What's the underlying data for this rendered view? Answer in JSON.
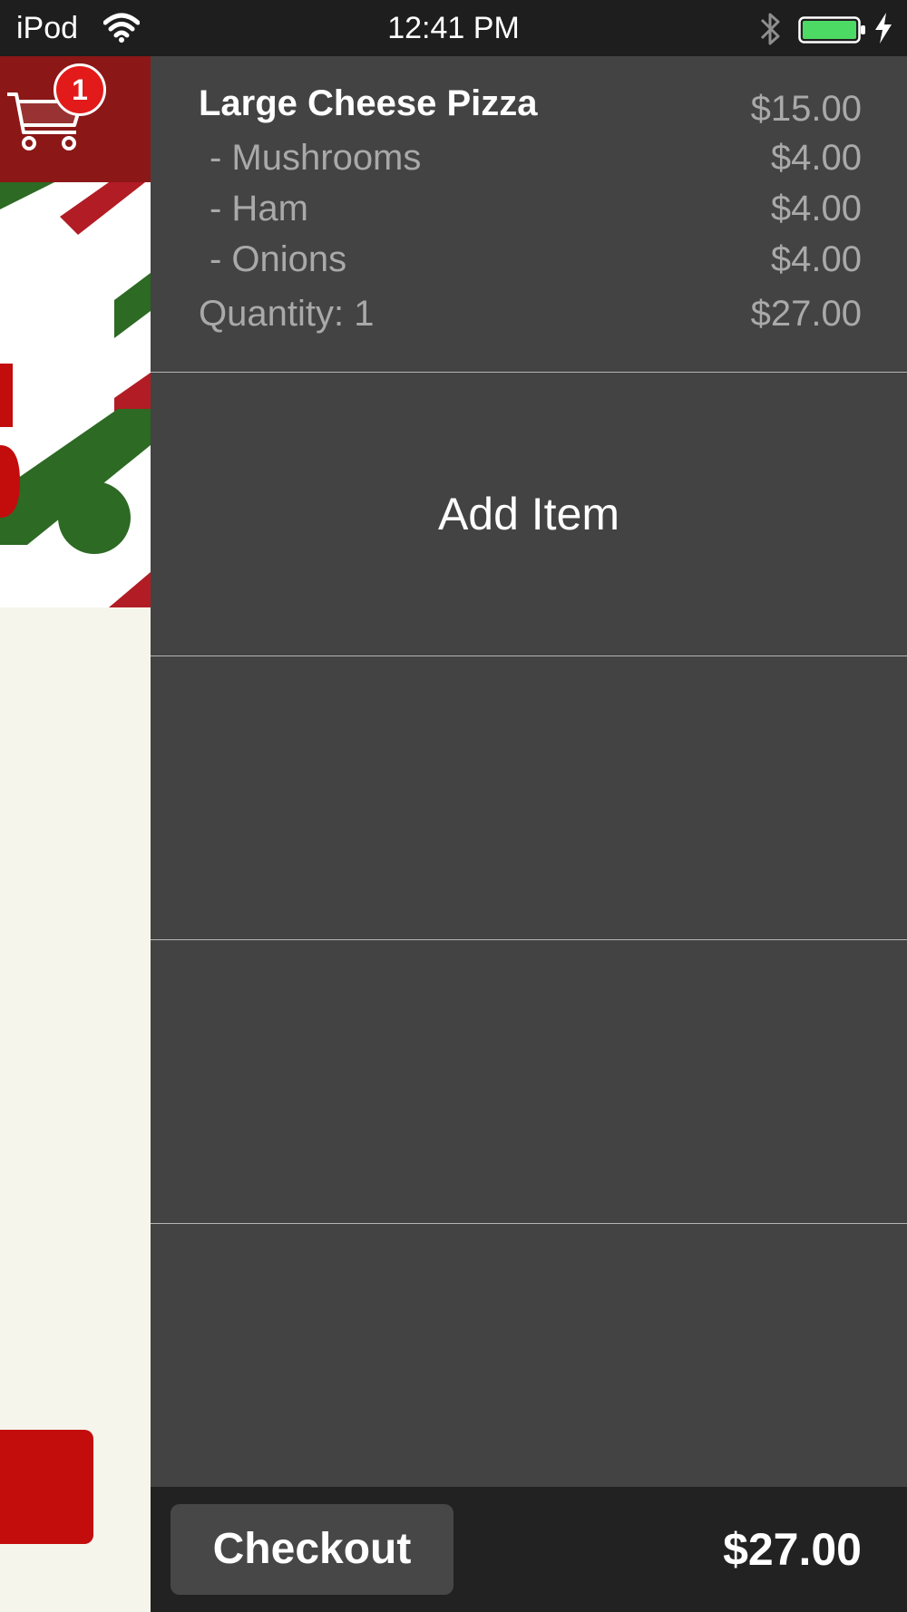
{
  "status_bar": {
    "carrier": "iPod",
    "time": "12:41 PM",
    "wifi_icon": "wifi-icon",
    "bluetooth_icon": "bluetooth-icon",
    "battery_icon": "battery-icon",
    "charging_icon": "charging-bolt-icon"
  },
  "header": {
    "cart_icon": "shopping-cart-icon",
    "cart_count": "1"
  },
  "cart": {
    "item": {
      "name": "Large Cheese Pizza",
      "base_price": "$15.00",
      "modifiers": [
        {
          "label": " - Mushrooms",
          "price": "$4.00"
        },
        {
          "label": " - Ham",
          "price": "$4.00"
        },
        {
          "label": " - Onions",
          "price": "$4.00"
        }
      ],
      "quantity_label": "Quantity: 1",
      "line_total": "$27.00"
    },
    "add_item_label": "Add Item"
  },
  "footer": {
    "checkout_label": "Checkout",
    "total": "$27.00"
  },
  "colors": {
    "header_red": "#8b1717",
    "badge_red": "#e31a1a",
    "panel_gray": "#434343",
    "footer_dark": "#222222",
    "battery_green": "#4cd964",
    "banner_green": "#2d6a24",
    "banner_red": "#b21c24"
  }
}
